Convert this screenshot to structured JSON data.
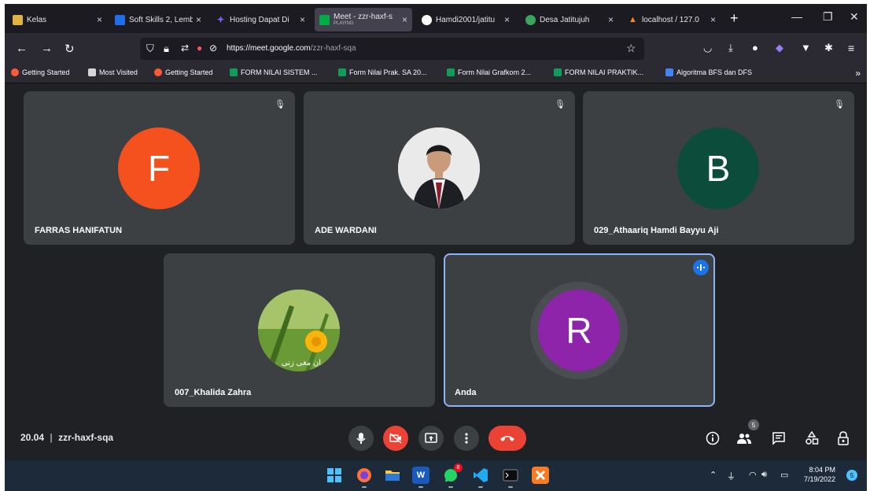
{
  "browser": {
    "tabs": [
      {
        "title": "Kelas",
        "favicon_color": "#e3b341",
        "glyph": "▣"
      },
      {
        "title": "Soft Skills 2, Lemb",
        "favicon_color": "#1f6feb",
        "glyph": "■"
      },
      {
        "title": "Hosting Dapat Di",
        "favicon_color": "#7a5af8",
        "glyph": "✦"
      },
      {
        "title": "Meet - zzr-haxf-s",
        "subtitle": "PLAYING",
        "favicon_color": "#00ac47",
        "glyph": "▶"
      },
      {
        "title": "Hamdi2001/jatitu",
        "favicon_color": "#ffffff",
        "glyph": "●"
      },
      {
        "title": "Desa Jatitujuh",
        "favicon_color": "#3ba55c",
        "glyph": "◉"
      },
      {
        "title": "localhost / 127.0",
        "favicon_color": "#f08a24",
        "glyph": "▲"
      }
    ],
    "url_host": "https://meet.google.com",
    "url_path": "/zzr-haxf-sqa",
    "bookmarks": [
      {
        "label": "Getting Started",
        "color": "#ff5a36"
      },
      {
        "label": "Most Visited",
        "color": "#d6d6d6"
      },
      {
        "label": "Getting Started",
        "color": "#ff5a36"
      },
      {
        "label": "FORM NILAI SISTEM ...",
        "color": "#0f9d58"
      },
      {
        "label": "Form Nilai Prak. SA 20...",
        "color": "#0f9d58"
      },
      {
        "label": "Form Nilai Grafkom 2...",
        "color": "#0f9d58"
      },
      {
        "label": "FORM NILAI PRAKTIK...",
        "color": "#0f9d58"
      },
      {
        "label": "Algoritma BFS dan DFS",
        "color": "#4285f4"
      }
    ]
  },
  "participants": [
    {
      "name": "FARRAS HANIFATUN",
      "initial": "F",
      "color": "#f4511e",
      "muted": true
    },
    {
      "name": "ADE WARDANI",
      "initial": "",
      "color": "#ffffff",
      "muted": true,
      "photo": true
    },
    {
      "name": "029_Athaariq Hamdi Bayyu Aji",
      "initial": "B",
      "color": "#0b4d3a",
      "muted": true
    },
    {
      "name": "007_Khalida Zahra",
      "initial": "",
      "color": "#7cb342",
      "muted": false,
      "photo": true,
      "overlay_text": "ان مغى زنى"
    },
    {
      "name": "Anda",
      "initial": "R",
      "color": "#8e24aa",
      "muted": false,
      "speaking": true
    }
  ],
  "meeting": {
    "time": "20.04",
    "separator": "|",
    "code": "zzr-haxf-sqa",
    "participant_count": "5"
  },
  "taskbar": {
    "time": "8:04 PM",
    "date": "7/19/2022",
    "notifications": "5",
    "whatsapp_badge": "8"
  }
}
